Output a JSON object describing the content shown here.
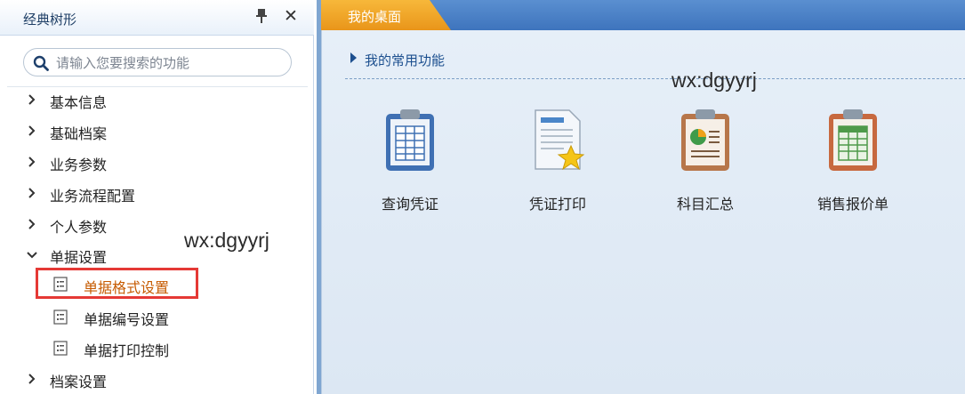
{
  "sidebar": {
    "title": "经典树形",
    "search_placeholder": "请输入您要搜索的功能",
    "items": [
      {
        "label": "基本信息",
        "expanded": false
      },
      {
        "label": "基础档案",
        "expanded": false
      },
      {
        "label": "业务参数",
        "expanded": false
      },
      {
        "label": "业务流程配置",
        "expanded": false
      },
      {
        "label": "个人参数",
        "expanded": false
      },
      {
        "label": "单据设置",
        "expanded": true
      },
      {
        "label": "档案设置",
        "expanded": false
      }
    ],
    "subitems": [
      {
        "label": "单据格式设置",
        "selected": true
      },
      {
        "label": "单据编号设置",
        "selected": false
      },
      {
        "label": "单据打印控制",
        "selected": false
      }
    ]
  },
  "watermark": "wx:dgyyrj",
  "main": {
    "tab_label": "我的桌面",
    "section_title": "我的常用功能",
    "functions": [
      {
        "label": "查询凭证",
        "icon": "clipboard-table-icon"
      },
      {
        "label": "凭证打印",
        "icon": "document-star-icon"
      },
      {
        "label": "科目汇总",
        "icon": "clipboard-chart-icon"
      },
      {
        "label": "销售报价单",
        "icon": "clipboard-sheet-icon"
      }
    ]
  },
  "colors": {
    "tab_active": "#f0a21a",
    "tabbar": "#4a80c6",
    "selection_border": "#e53935",
    "selected_text": "#c65a00",
    "section_title": "#1c4f8f"
  }
}
